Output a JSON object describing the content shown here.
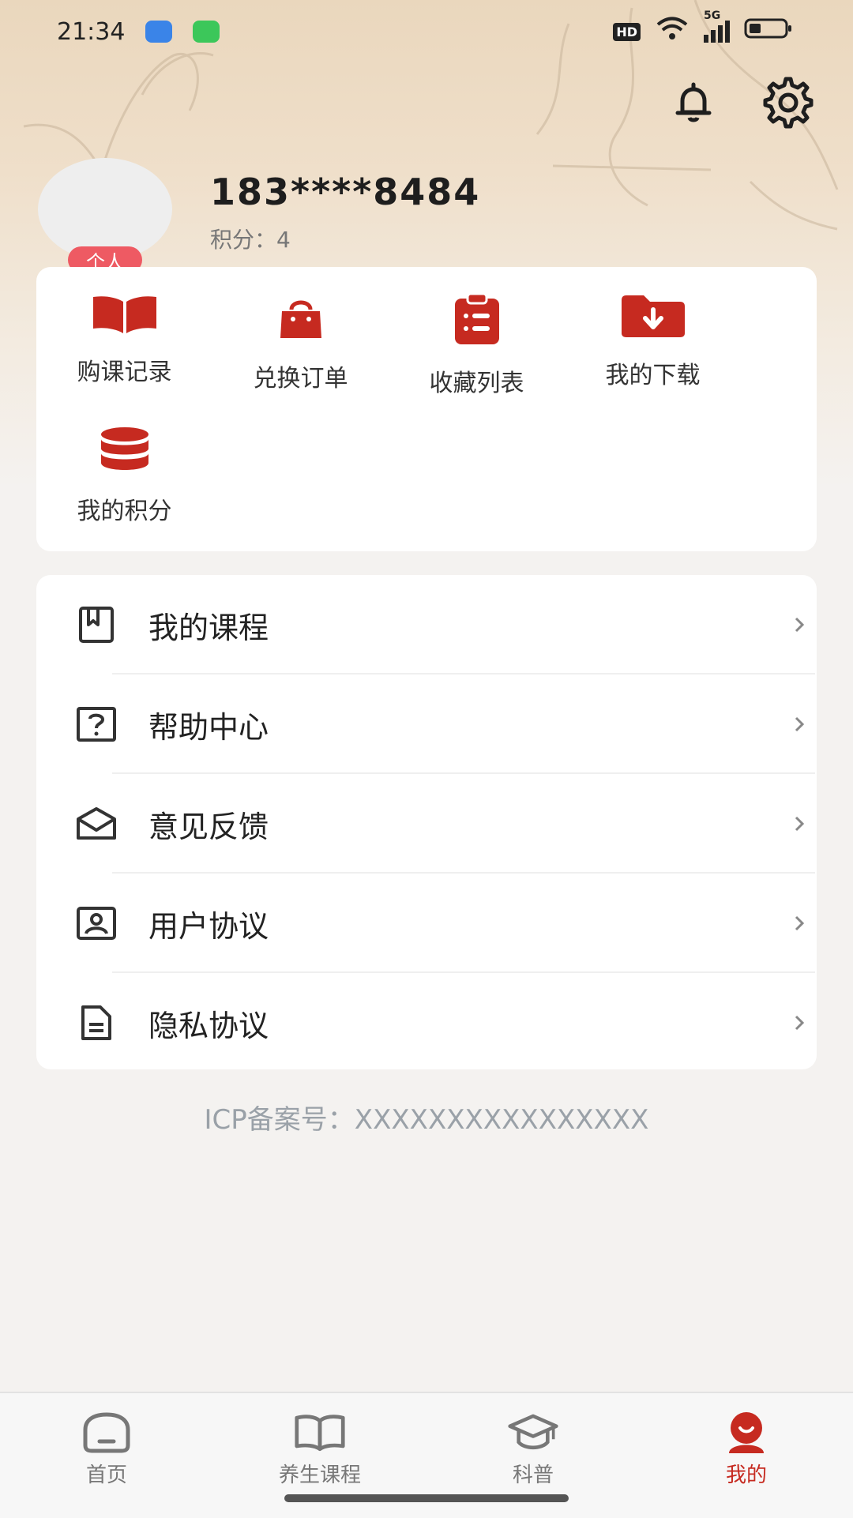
{
  "status_bar": {
    "time": "21:34",
    "hd": "HD",
    "net": "5G",
    "icons": [
      "app-blue-icon",
      "message-green-icon",
      "wifi-icon",
      "signal-icon",
      "battery-icon"
    ]
  },
  "header": {
    "icons": [
      "bell-icon",
      "gear-icon"
    ]
  },
  "profile": {
    "phone": "183****8484",
    "points_text": "积分：4",
    "badge": "个人"
  },
  "quick_actions": [
    {
      "label": "购课记录",
      "icon": "book-open-icon"
    },
    {
      "label": "兑换订单",
      "icon": "shopping-bag-icon"
    },
    {
      "label": "收藏列表",
      "icon": "clipboard-list-icon"
    },
    {
      "label": "我的下载",
      "icon": "folder-download-icon"
    },
    {
      "label": "我的积分",
      "icon": "coin-stack-icon"
    }
  ],
  "menu": [
    {
      "label": "我的课程",
      "icon": "bookmark-book-icon"
    },
    {
      "label": "帮助中心",
      "icon": "help-question-icon"
    },
    {
      "label": "意见反馈",
      "icon": "mail-open-icon"
    },
    {
      "label": "用户协议",
      "icon": "user-card-icon"
    },
    {
      "label": "隐私协议",
      "icon": "document-icon"
    }
  ],
  "icp_text": "ICP备案号：XXXXXXXXXXXXXXXX",
  "tabs": [
    {
      "label": "首页",
      "icon": "home-icon",
      "active": false
    },
    {
      "label": "养生课程",
      "icon": "book-icon",
      "active": false
    },
    {
      "label": "科普",
      "icon": "graduation-cap-icon",
      "active": false
    },
    {
      "label": "我的",
      "icon": "user-avatar-icon",
      "active": true
    }
  ],
  "colors": {
    "accent": "#c62a20",
    "badge": "#ee5a63",
    "icp_text": "#9aa1a8"
  }
}
